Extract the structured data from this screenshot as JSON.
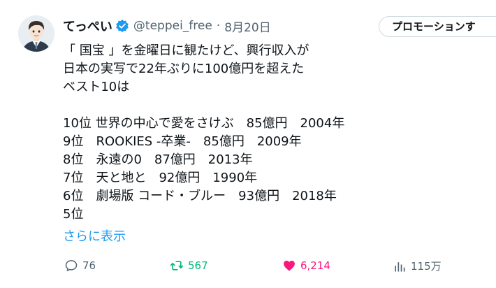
{
  "author": {
    "display_name": "てっぺい",
    "handle": "@teppei_free",
    "separator": "·",
    "date": "8月20日"
  },
  "promo_button": {
    "label": "プロモーションす"
  },
  "tweet": {
    "lines": [
      "「 国宝 」を金曜日に観たけど、興行収入が",
      "日本の実写で22年ぶりに100億円を超えた",
      "ベスト10は",
      "",
      "10位 世界の中心で愛をさけぶ　85億円　2004年",
      "9位　ROOKIES -卒業-　85億円　2009年",
      "8位　永遠の0　87億円　2013年",
      "7位　天と地と　92億円　1990年",
      "6位　劇場版 コード・ブルー　93億円　2018年",
      "5位"
    ],
    "show_more": "さらに表示"
  },
  "actions": {
    "replies": "76",
    "retweets": "567",
    "likes": "6,214",
    "views": "115万"
  },
  "icons": {
    "verified": "verified-badge-icon",
    "reply": "reply-icon",
    "retweet": "retweet-icon",
    "like": "heart-icon",
    "views": "views-icon"
  },
  "colors": {
    "accent": "#1d9bf0",
    "retweet": "#00ba7c",
    "like": "#f91880",
    "muted": "#536471"
  }
}
